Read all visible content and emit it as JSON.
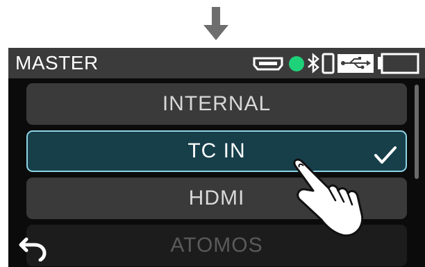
{
  "header": {
    "title": "MASTER"
  },
  "status_icons": [
    "hdmi-icon",
    "green-status-dot-icon",
    "bluetooth-icon",
    "phone-icon",
    "usb-icon",
    "battery-icon"
  ],
  "list": {
    "items": [
      {
        "label": "INTERNAL",
        "selected": false
      },
      {
        "label": "TC IN",
        "selected": true
      },
      {
        "label": "HDMI",
        "selected": false
      },
      {
        "label": "ATOMOS",
        "selected": false
      }
    ]
  },
  "colors": {
    "accent": "#8fd4e6",
    "selected_bg": "#163f4a",
    "status_dot": "#1ed27a"
  },
  "icons": {
    "back": "back-arrow-icon",
    "check": "checkmark-icon",
    "pointer": "hand-pointer-icon",
    "top_arrow": "down-arrow-icon"
  }
}
